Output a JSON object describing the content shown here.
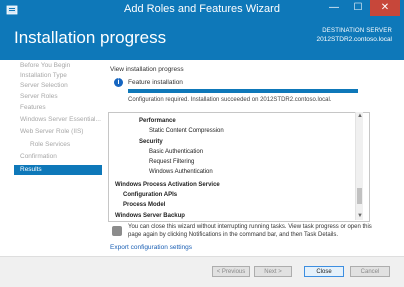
{
  "window": {
    "title": "Add Roles and Features Wizard",
    "controls": {
      "minimize": "—",
      "maximize": "☐",
      "close": "✕"
    }
  },
  "header": {
    "heading": "Installation progress",
    "destination_label": "DESTINATION SERVER",
    "destination_server": "2012STDR2.contoso.local"
  },
  "nav": {
    "items": [
      {
        "label": "Before You Begin"
      },
      {
        "label": "Installation Type"
      },
      {
        "label": "Server Selection"
      },
      {
        "label": "Server Roles"
      },
      {
        "label": "Features"
      },
      {
        "label": "Windows Server Essential..."
      },
      {
        "label": "Web Server Role (IIS)"
      },
      {
        "label": "Role Services"
      },
      {
        "label": "Confirmation"
      },
      {
        "label": "Results"
      }
    ]
  },
  "content": {
    "section_title": "View installation progress",
    "feature_label": "Feature installation",
    "progress_percent": 100,
    "status_message": "Configuration required. Installation succeeded on 2012STDR2.contoso.local.",
    "list_items": [
      {
        "label": "Performance",
        "level": 3
      },
      {
        "label": "Static Content Compression",
        "level": 4
      },
      {
        "label": "Security",
        "level": 3
      },
      {
        "label": "Basic Authentication",
        "level": 4
      },
      {
        "label": "Request Filtering",
        "level": 4
      },
      {
        "label": "Windows Authentication",
        "level": 4
      },
      {
        "label": "Windows Process Activation Service",
        "level": 1
      },
      {
        "label": "Configuration APIs",
        "level": 2
      },
      {
        "label": "Process Model",
        "level": 2
      },
      {
        "label": "Windows Server Backup",
        "level": 1
      }
    ],
    "scroll_up": "▲",
    "scroll_down": "▼",
    "note": "You can close this wizard without interrupting running tasks. View task progress or open this page again by clicking Notifications in the command bar, and then Task Details.",
    "export_link": "Export configuration settings"
  },
  "footer": {
    "previous": "< Previous",
    "next": "Next >",
    "close": "Close",
    "cancel": "Cancel"
  },
  "colors": {
    "accent": "#0e78b9",
    "close_button": "#c7473a",
    "link": "#1a5fb4"
  }
}
